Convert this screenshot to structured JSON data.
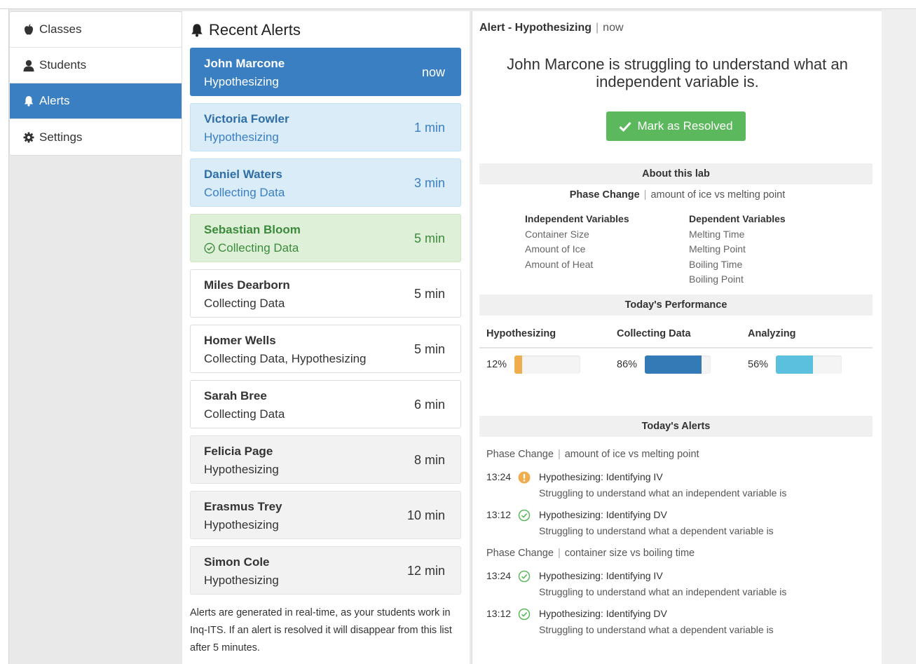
{
  "nav": {
    "items": [
      {
        "label": "Classes",
        "icon": "apple-icon"
      },
      {
        "label": "Students",
        "icon": "user-icon"
      },
      {
        "label": "Alerts",
        "icon": "bell-icon",
        "active": true
      },
      {
        "label": "Settings",
        "icon": "gear-icon"
      }
    ]
  },
  "alerts": {
    "title": "Recent Alerts",
    "items": [
      {
        "name": "John Marcone",
        "phase": "Hypothesizing",
        "time": "now",
        "style": "active"
      },
      {
        "name": "Victoria Fowler",
        "phase": "Hypothesizing",
        "time": "1 min",
        "style": "info"
      },
      {
        "name": "Daniel Waters",
        "phase": "Collecting Data",
        "time": "3 min",
        "style": "info"
      },
      {
        "name": "Sebastian Bloom",
        "phase": "Collecting Data",
        "time": "5 min",
        "style": "success",
        "resolved": true
      },
      {
        "name": "Miles Dearborn",
        "phase": "Collecting Data",
        "time": "5 min",
        "style": "plain"
      },
      {
        "name": "Homer Wells",
        "phase": "Collecting Data, Hypothesizing",
        "time": "5 min",
        "style": "plain"
      },
      {
        "name": "Sarah Bree",
        "phase": "Collecting Data",
        "time": "6 min",
        "style": "plain"
      },
      {
        "name": "Felicia Page",
        "phase": "Hypothesizing",
        "time": "8 min",
        "style": "gray"
      },
      {
        "name": "Erasmus Trey",
        "phase": "Hypothesizing",
        "time": "10 min",
        "style": "gray"
      },
      {
        "name": "Simon Cole",
        "phase": "Hypothesizing",
        "time": "12 min",
        "style": "gray"
      }
    ],
    "note": "Alerts are generated in real-time, as your students work in Inq-ITS. If an alert is resolved it will disappear from this list after 5 minutes."
  },
  "detail": {
    "header_label": "Alert - Hypothesizing",
    "header_time": "now",
    "message": "John Marcone is struggling to understand what an independent variable is.",
    "resolve_label": "Mark as Resolved",
    "about": {
      "title": "About this lab",
      "lab_name": "Phase Change",
      "lab_desc": "amount of ice vs melting point",
      "independent_title": "Independent Variables",
      "independent": [
        "Container Size",
        "Amount of Ice",
        "Amount of Heat"
      ],
      "dependent_title": "Dependent Variables",
      "dependent": [
        "Melting Time",
        "Melting Point",
        "Boiling Time",
        "Boiling Point"
      ]
    },
    "performance": {
      "title": "Today's Performance",
      "items": [
        {
          "label": "Hypothesizing",
          "pct_label": "12%",
          "value": 0.12,
          "color": "#f0ad4e"
        },
        {
          "label": "Collecting Data",
          "pct_label": "86%",
          "value": 0.86,
          "color": "#337ab7"
        },
        {
          "label": "Analyzing",
          "pct_label": "56%",
          "value": 0.56,
          "color": "#5bc0de"
        }
      ]
    },
    "today_alerts": {
      "title": "Today's Alerts",
      "groups": [
        {
          "lab": "Phase Change",
          "desc": "amount of ice vs melting point",
          "entries": [
            {
              "time": "13:24",
              "status": "warning",
              "title": "Hypothesizing: Identifying IV",
              "desc": "Struggling to understand what an independent variable is"
            },
            {
              "time": "13:12",
              "status": "resolved",
              "title": "Hypothesizing: Identifying DV",
              "desc": "Struggling to understand what a dependent variable is"
            }
          ]
        },
        {
          "lab": "Phase Change",
          "desc": "container size vs boiling time",
          "entries": [
            {
              "time": "13:24",
              "status": "resolved",
              "title": "Hypothesizing: Identifying IV",
              "desc": "Struggling to understand what an independent variable is"
            },
            {
              "time": "13:12",
              "status": "resolved",
              "title": "Hypothesizing: Identifying DV",
              "desc": "Struggling to understand what a dependent variable is"
            }
          ]
        }
      ]
    }
  }
}
